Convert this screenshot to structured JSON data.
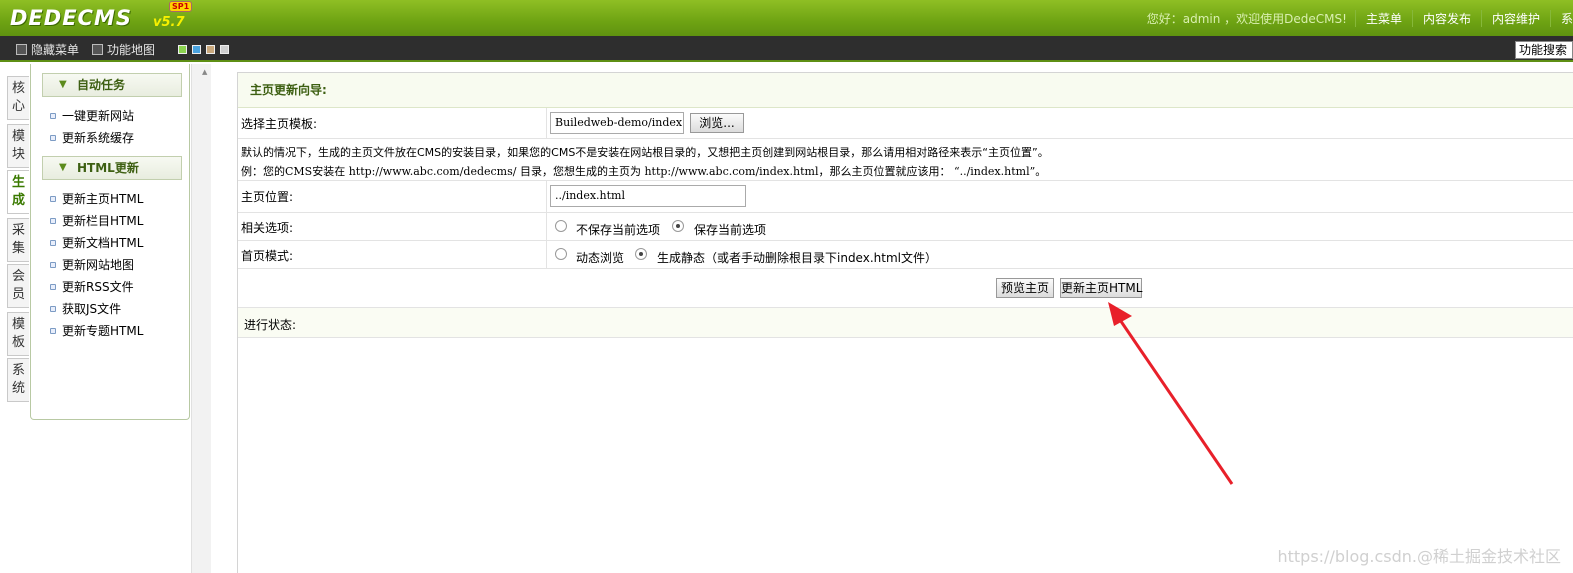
{
  "header": {
    "logo_text": "DEDECMS",
    "logo_version": "v5.7",
    "logo_badge": "SP1",
    "welcome": "您好：admin ，欢迎使用DedeCMS!",
    "nav": [
      "主菜单",
      "内容发布",
      "内容维护",
      "系"
    ]
  },
  "subbar": {
    "hide_menu": "隐藏菜单",
    "site_map": "功能地图",
    "skin_colors": [
      "#8bd34f",
      "#4aa3df",
      "#c9a87c",
      "#d0d0d0"
    ],
    "func_search": "功能搜索"
  },
  "vtabs": [
    {
      "label": "核心",
      "active": false
    },
    {
      "label": "模块",
      "active": false
    },
    {
      "label": "生成",
      "active": true
    },
    {
      "label": "采集",
      "active": false
    },
    {
      "label": "会员",
      "active": false
    },
    {
      "label": "模板",
      "active": false
    },
    {
      "label": "系统",
      "active": false
    }
  ],
  "sidebar": {
    "group1": {
      "title": "自动任务",
      "items": [
        "一键更新网站",
        "更新系统缓存"
      ]
    },
    "group2": {
      "title": "HTML更新",
      "items": [
        "更新主页HTML",
        "更新栏目HTML",
        "更新文档HTML",
        "更新网站地图",
        "更新RSS文件",
        "获取JS文件",
        "更新专题HTML"
      ]
    }
  },
  "main": {
    "title": "主页更新向导:",
    "template_label": "选择主页模板:",
    "template_value": "Builedweb-demo/index.",
    "browse_button": "浏览...",
    "note_line1": "默认的情况下，生成的主页文件放在CMS的安装目录，如果您的CMS不是安装在网站根目录的，又想把主页创建到网站根目录，那么请用相对路径来表示“主页位置”。",
    "note_line2": "例：您的CMS安装在 http://www.abc.com/dedecms/ 目录，您想生成的主页为 http://www.abc.com/index.html，那么主页位置就应该用： “../index.html”。",
    "position_label": "主页位置:",
    "position_value": "../index.html",
    "options_label": "相关选项:",
    "option_no_save": "不保存当前选项",
    "option_save": "保存当前选项",
    "mode_label": "首页模式:",
    "mode_dynamic": "动态浏览",
    "mode_static": "生成静态（或者手动删除根目录下index.html文件）",
    "preview_button": "预览主页",
    "update_button": "更新主页HTML",
    "status_label": "进行状态:"
  },
  "watermark": "https://blog.csdn.@稀土掘金技术社区"
}
